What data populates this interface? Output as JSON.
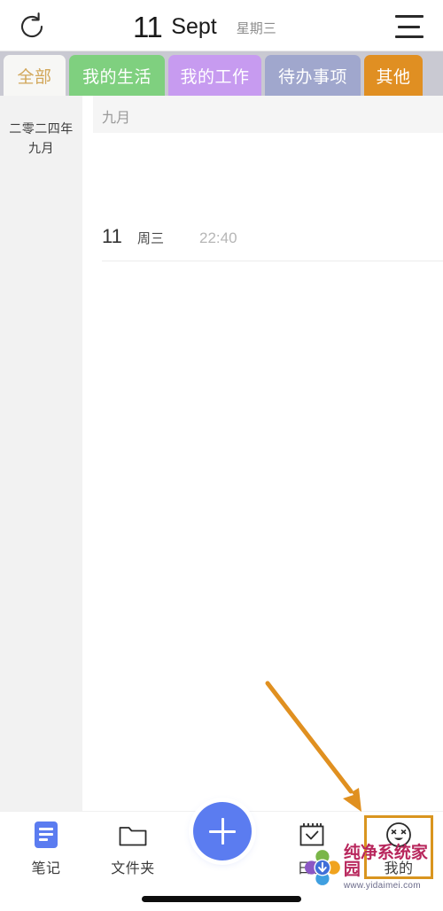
{
  "header": {
    "refresh_icon": "refresh-icon",
    "day": "11",
    "month": "Sept",
    "weekday": "星期三",
    "menu_icon": "hamburger-menu-icon"
  },
  "tabs": [
    {
      "label": "全部",
      "color": "#f7f7f5",
      "text_color": "#d2a75a",
      "active": true
    },
    {
      "label": "我的生活",
      "color": "#7fd07f",
      "text_color": "#ffffff",
      "active": false
    },
    {
      "label": "我的工作",
      "color": "#c79bf0",
      "text_color": "#ffffff",
      "active": false
    },
    {
      "label": "待办事项",
      "color": "#a0a7cd",
      "text_color": "#ffffff",
      "active": false
    },
    {
      "label": "其他",
      "color": "#e08f22",
      "text_color": "#ffffff",
      "active": false
    }
  ],
  "tabstrip": {
    "background": "#c9c9d2"
  },
  "sidebar": {
    "year_label": "二零二四年",
    "month_label": "九月",
    "background": "#f2f2f2"
  },
  "content": {
    "month_header": "九月",
    "notes": [
      {
        "day": "11",
        "weekday": "周三",
        "time": "22:40"
      }
    ]
  },
  "bottom_nav": {
    "items": [
      {
        "label": "笔记",
        "icon": "notes-icon",
        "active": true
      },
      {
        "label": "文件夹",
        "icon": "folder-icon",
        "active": false
      },
      {
        "label": "日历",
        "icon": "calendar-icon",
        "active": false
      },
      {
        "label": "我的",
        "icon": "face-icon",
        "active": false,
        "highlighted": true
      }
    ],
    "add_button": {
      "icon": "plus-icon",
      "color": "#5b7cf0"
    }
  },
  "annotation": {
    "arrow_color": "#e09020",
    "highlight_color": "#d9951f",
    "target": "我的"
  },
  "watermark": {
    "title": "纯净系统家园",
    "url": "www.yidaimei.com"
  }
}
